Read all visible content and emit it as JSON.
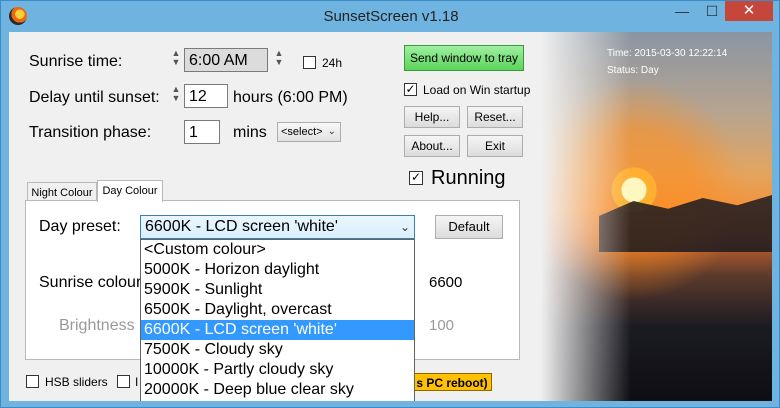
{
  "window": {
    "title": "SunsetScreen v1.18",
    "minimize": "—",
    "maximize": "☐",
    "close": "✕"
  },
  "settings": {
    "sunrise_label": "Sunrise time:",
    "sunrise_value": "6:00 AM",
    "h24_label": "24h",
    "delay_label": "Delay until sunset:",
    "delay_value": "12",
    "delay_unit": "hours  (6:00 PM)",
    "transition_label": "Transition phase:",
    "transition_value": "1",
    "transition_unit": "mins",
    "transition_select": "<select>"
  },
  "buttons": {
    "tray": "Send window to tray",
    "startup_label": "Load on Win startup",
    "help": "Help...",
    "reset": "Reset...",
    "about": "About...",
    "exit": "Exit",
    "running_label": "Running",
    "default": "Default"
  },
  "status": {
    "time": "Time: 2015-03-30 12:22:14",
    "status": "Status: Day"
  },
  "tabs": {
    "night": "Night Colour",
    "day": "Day Colour"
  },
  "day": {
    "preset_label": "Day preset:",
    "preset_value": "6600K - LCD screen 'white'",
    "sunrise_colour_label": "Sunrise colour",
    "sunrise_colour_value": "6600",
    "brightness_label": "Brightness",
    "brightness_value": "100"
  },
  "preset_options": [
    "<Custom colour>",
    "5000K - Horizon daylight",
    "5900K - Sunlight",
    "6500K - Daylight, overcast",
    "6600K - LCD screen 'white'",
    "7500K - Cloudy sky",
    "10000K - Partly cloudy sky",
    "20000K - Deep blue clear sky"
  ],
  "bottom": {
    "hsb_label": "HSB sliders",
    "partial_label": "I",
    "reboot_text": "s PC reboot)"
  },
  "colors": {
    "titlebar": "#6fb4e0",
    "close": "#c7463b",
    "selection": "#3399ff",
    "tray_button": "#5bd45b",
    "reboot_badge": "#ffc000"
  }
}
